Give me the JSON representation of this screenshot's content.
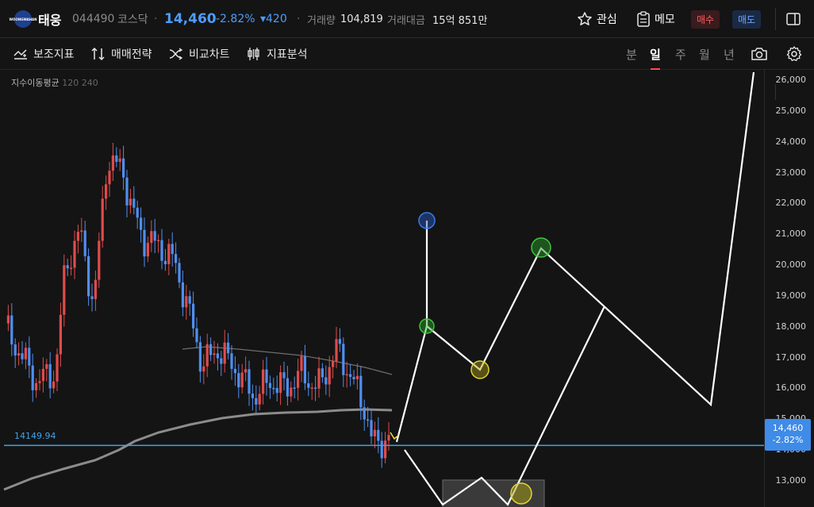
{
  "stock": {
    "logo_text": "WOONGWAHAN",
    "name": "태웅",
    "code": "044490",
    "market": "코스닥",
    "price": "14,460",
    "change_pct": "-2.82%",
    "change_abs": "▾420",
    "volume_label": "거래량",
    "volume": "104,819",
    "amount_label": "거래대금",
    "amount": "15억 851만"
  },
  "actions": {
    "watch": "관심",
    "memo": "메모",
    "buy": "매수",
    "sell": "매도"
  },
  "toolbar": {
    "indicators": "보조지표",
    "strategy": "매매전략",
    "compare": "비교차트",
    "analysis": "지표분석",
    "periods": [
      "분",
      "일",
      "주",
      "월",
      "년"
    ],
    "active_period": "일"
  },
  "chart": {
    "indicator_name": "지수이동평균",
    "indicator_params": "120 240",
    "hline_label": "14149.94",
    "hline_value": 14149.94,
    "price_tag": "14,460",
    "price_tag_change": "-2.82%",
    "y_ticks": [
      "26,000",
      "25,000",
      "24,000",
      "23,000",
      "22,000",
      "21,000",
      "20,000",
      "19,000",
      "18,000",
      "17,000",
      "16,000",
      "15,000",
      "14,000",
      "13,000"
    ],
    "colors": {
      "up": "#e04b4b",
      "down": "#4f8ff0",
      "hline": "#3fa3e8",
      "ma120": "#6e6e6e",
      "ma240": "#8c8c8c",
      "drawing": "#ffffff",
      "tag": "#3f8be8"
    }
  }
}
